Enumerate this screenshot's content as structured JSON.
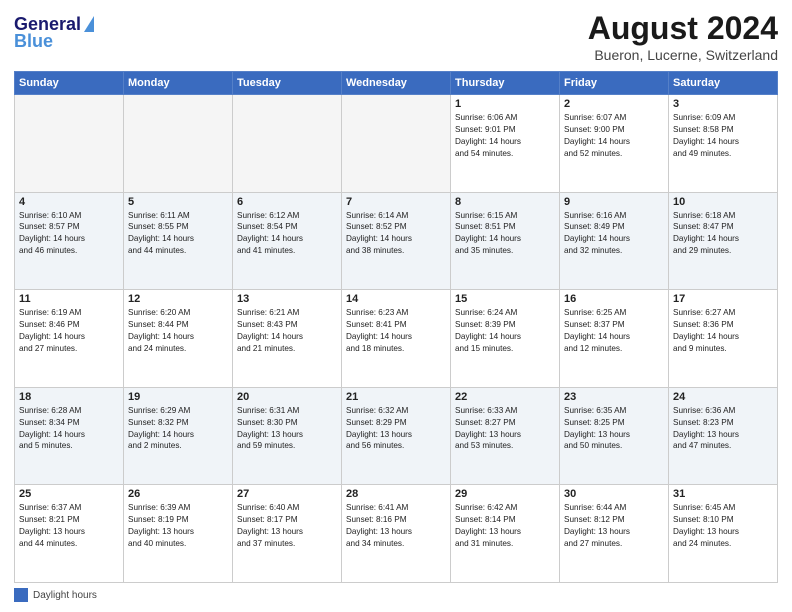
{
  "header": {
    "logo_general": "General",
    "logo_blue": "Blue",
    "title": "August 2024",
    "subtitle": "Bueron, Lucerne, Switzerland"
  },
  "days_of_week": [
    "Sunday",
    "Monday",
    "Tuesday",
    "Wednesday",
    "Thursday",
    "Friday",
    "Saturday"
  ],
  "legend_label": "Daylight hours",
  "weeks": [
    {
      "row_alt": false,
      "days": [
        {
          "num": "",
          "info": "",
          "empty": true
        },
        {
          "num": "",
          "info": "",
          "empty": true
        },
        {
          "num": "",
          "info": "",
          "empty": true
        },
        {
          "num": "",
          "info": "",
          "empty": true
        },
        {
          "num": "1",
          "info": "Sunrise: 6:06 AM\nSunset: 9:01 PM\nDaylight: 14 hours\nand 54 minutes.",
          "empty": false
        },
        {
          "num": "2",
          "info": "Sunrise: 6:07 AM\nSunset: 9:00 PM\nDaylight: 14 hours\nand 52 minutes.",
          "empty": false
        },
        {
          "num": "3",
          "info": "Sunrise: 6:09 AM\nSunset: 8:58 PM\nDaylight: 14 hours\nand 49 minutes.",
          "empty": false
        }
      ]
    },
    {
      "row_alt": true,
      "days": [
        {
          "num": "4",
          "info": "Sunrise: 6:10 AM\nSunset: 8:57 PM\nDaylight: 14 hours\nand 46 minutes.",
          "empty": false
        },
        {
          "num": "5",
          "info": "Sunrise: 6:11 AM\nSunset: 8:55 PM\nDaylight: 14 hours\nand 44 minutes.",
          "empty": false
        },
        {
          "num": "6",
          "info": "Sunrise: 6:12 AM\nSunset: 8:54 PM\nDaylight: 14 hours\nand 41 minutes.",
          "empty": false
        },
        {
          "num": "7",
          "info": "Sunrise: 6:14 AM\nSunset: 8:52 PM\nDaylight: 14 hours\nand 38 minutes.",
          "empty": false
        },
        {
          "num": "8",
          "info": "Sunrise: 6:15 AM\nSunset: 8:51 PM\nDaylight: 14 hours\nand 35 minutes.",
          "empty": false
        },
        {
          "num": "9",
          "info": "Sunrise: 6:16 AM\nSunset: 8:49 PM\nDaylight: 14 hours\nand 32 minutes.",
          "empty": false
        },
        {
          "num": "10",
          "info": "Sunrise: 6:18 AM\nSunset: 8:47 PM\nDaylight: 14 hours\nand 29 minutes.",
          "empty": false
        }
      ]
    },
    {
      "row_alt": false,
      "days": [
        {
          "num": "11",
          "info": "Sunrise: 6:19 AM\nSunset: 8:46 PM\nDaylight: 14 hours\nand 27 minutes.",
          "empty": false
        },
        {
          "num": "12",
          "info": "Sunrise: 6:20 AM\nSunset: 8:44 PM\nDaylight: 14 hours\nand 24 minutes.",
          "empty": false
        },
        {
          "num": "13",
          "info": "Sunrise: 6:21 AM\nSunset: 8:43 PM\nDaylight: 14 hours\nand 21 minutes.",
          "empty": false
        },
        {
          "num": "14",
          "info": "Sunrise: 6:23 AM\nSunset: 8:41 PM\nDaylight: 14 hours\nand 18 minutes.",
          "empty": false
        },
        {
          "num": "15",
          "info": "Sunrise: 6:24 AM\nSunset: 8:39 PM\nDaylight: 14 hours\nand 15 minutes.",
          "empty": false
        },
        {
          "num": "16",
          "info": "Sunrise: 6:25 AM\nSunset: 8:37 PM\nDaylight: 14 hours\nand 12 minutes.",
          "empty": false
        },
        {
          "num": "17",
          "info": "Sunrise: 6:27 AM\nSunset: 8:36 PM\nDaylight: 14 hours\nand 9 minutes.",
          "empty": false
        }
      ]
    },
    {
      "row_alt": true,
      "days": [
        {
          "num": "18",
          "info": "Sunrise: 6:28 AM\nSunset: 8:34 PM\nDaylight: 14 hours\nand 5 minutes.",
          "empty": false
        },
        {
          "num": "19",
          "info": "Sunrise: 6:29 AM\nSunset: 8:32 PM\nDaylight: 14 hours\nand 2 minutes.",
          "empty": false
        },
        {
          "num": "20",
          "info": "Sunrise: 6:31 AM\nSunset: 8:30 PM\nDaylight: 13 hours\nand 59 minutes.",
          "empty": false
        },
        {
          "num": "21",
          "info": "Sunrise: 6:32 AM\nSunset: 8:29 PM\nDaylight: 13 hours\nand 56 minutes.",
          "empty": false
        },
        {
          "num": "22",
          "info": "Sunrise: 6:33 AM\nSunset: 8:27 PM\nDaylight: 13 hours\nand 53 minutes.",
          "empty": false
        },
        {
          "num": "23",
          "info": "Sunrise: 6:35 AM\nSunset: 8:25 PM\nDaylight: 13 hours\nand 50 minutes.",
          "empty": false
        },
        {
          "num": "24",
          "info": "Sunrise: 6:36 AM\nSunset: 8:23 PM\nDaylight: 13 hours\nand 47 minutes.",
          "empty": false
        }
      ]
    },
    {
      "row_alt": false,
      "days": [
        {
          "num": "25",
          "info": "Sunrise: 6:37 AM\nSunset: 8:21 PM\nDaylight: 13 hours\nand 44 minutes.",
          "empty": false
        },
        {
          "num": "26",
          "info": "Sunrise: 6:39 AM\nSunset: 8:19 PM\nDaylight: 13 hours\nand 40 minutes.",
          "empty": false
        },
        {
          "num": "27",
          "info": "Sunrise: 6:40 AM\nSunset: 8:17 PM\nDaylight: 13 hours\nand 37 minutes.",
          "empty": false
        },
        {
          "num": "28",
          "info": "Sunrise: 6:41 AM\nSunset: 8:16 PM\nDaylight: 13 hours\nand 34 minutes.",
          "empty": false
        },
        {
          "num": "29",
          "info": "Sunrise: 6:42 AM\nSunset: 8:14 PM\nDaylight: 13 hours\nand 31 minutes.",
          "empty": false
        },
        {
          "num": "30",
          "info": "Sunrise: 6:44 AM\nSunset: 8:12 PM\nDaylight: 13 hours\nand 27 minutes.",
          "empty": false
        },
        {
          "num": "31",
          "info": "Sunrise: 6:45 AM\nSunset: 8:10 PM\nDaylight: 13 hours\nand 24 minutes.",
          "empty": false
        }
      ]
    }
  ]
}
